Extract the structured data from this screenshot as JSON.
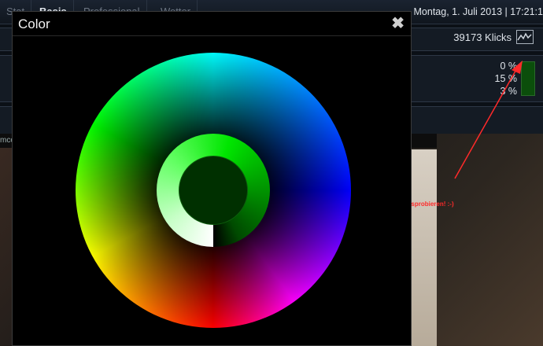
{
  "topbar": {
    "tabs": [
      "Stat",
      "Basis",
      "Professional",
      "Wetter"
    ],
    "active_tab": "Basis",
    "datetime": "Montag, 1. Juli 2013 | 17:21:1"
  },
  "stats": {
    "clicks": "39173 Klicks",
    "percentages": [
      "0 %",
      "15 %",
      "3 %"
    ]
  },
  "photo": {
    "header": "mco"
  },
  "annotation": {
    "text": "Da klicken zum Ausprobieren! :-)"
  },
  "modal": {
    "title": "Color",
    "close": "✖"
  },
  "colors": {
    "annotation": "#ff2a2a",
    "selected_color": "#003000"
  }
}
